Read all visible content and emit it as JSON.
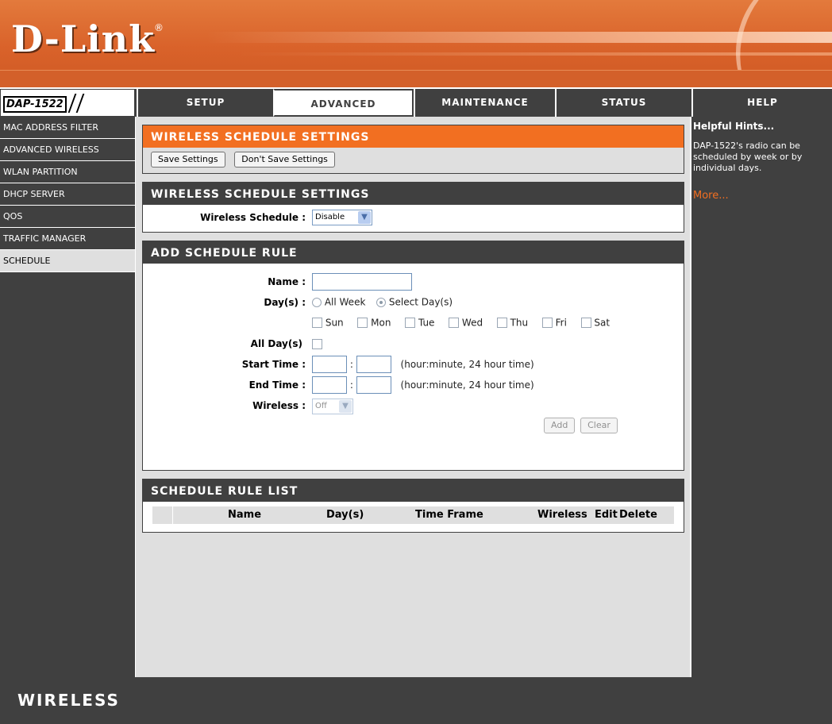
{
  "brand": {
    "logo": "D-Link",
    "registered": "®",
    "model": "DAP-1522",
    "footer": "WIRELESS"
  },
  "nav": {
    "tabs": [
      {
        "label": "SETUP"
      },
      {
        "label": "ADVANCED"
      },
      {
        "label": "MAINTENANCE"
      },
      {
        "label": "STATUS"
      },
      {
        "label": "HELP"
      }
    ],
    "active_tab": "ADVANCED"
  },
  "sidebar": {
    "items": [
      {
        "label": "MAC ADDRESS FILTER"
      },
      {
        "label": "ADVANCED WIRELESS"
      },
      {
        "label": "WLAN PARTITION"
      },
      {
        "label": "DHCP SERVER"
      },
      {
        "label": "QOS"
      },
      {
        "label": "TRAFFIC MANAGER"
      },
      {
        "label": "SCHEDULE"
      }
    ],
    "active_item": "SCHEDULE"
  },
  "settings_bar": {
    "title": "WIRELESS SCHEDULE SETTINGS",
    "save_label": "Save Settings",
    "dont_save_label": "Don't Save Settings"
  },
  "schedule_settings": {
    "title": "WIRELESS SCHEDULE SETTINGS",
    "label": "Wireless Schedule :",
    "value": "Disable"
  },
  "add_rule": {
    "title": "ADD SCHEDULE RULE",
    "name_label": "Name :",
    "name_value": "",
    "days_label": "Day(s) :",
    "all_week_label": "All Week",
    "select_days_label": "Select Day(s)",
    "selected_mode": "Select Day(s)",
    "days": [
      "Sun",
      "Mon",
      "Tue",
      "Wed",
      "Thu",
      "Fri",
      "Sat"
    ],
    "all_days_label": "All Day(s)",
    "start_label": "Start Time :",
    "end_label": "End Time :",
    "time_sep": ":",
    "time_hint": "(hour:minute, 24 hour time)",
    "wireless_label": "Wireless :",
    "wireless_value": "Off",
    "add_label": "Add",
    "clear_label": "Clear"
  },
  "rule_list": {
    "title": "SCHEDULE RULE LIST",
    "columns": [
      "Name",
      "Day(s)",
      "Time Frame",
      "Wireless",
      "Edit",
      "Delete"
    ],
    "rows": []
  },
  "help": {
    "title": "Helpful Hints...",
    "text": "DAP-1522's radio can be scheduled by week or by individual days.",
    "more": "More..."
  },
  "colors": {
    "orange": "#f26f21",
    "dark": "#404040",
    "panel": "#dfdfdf"
  }
}
